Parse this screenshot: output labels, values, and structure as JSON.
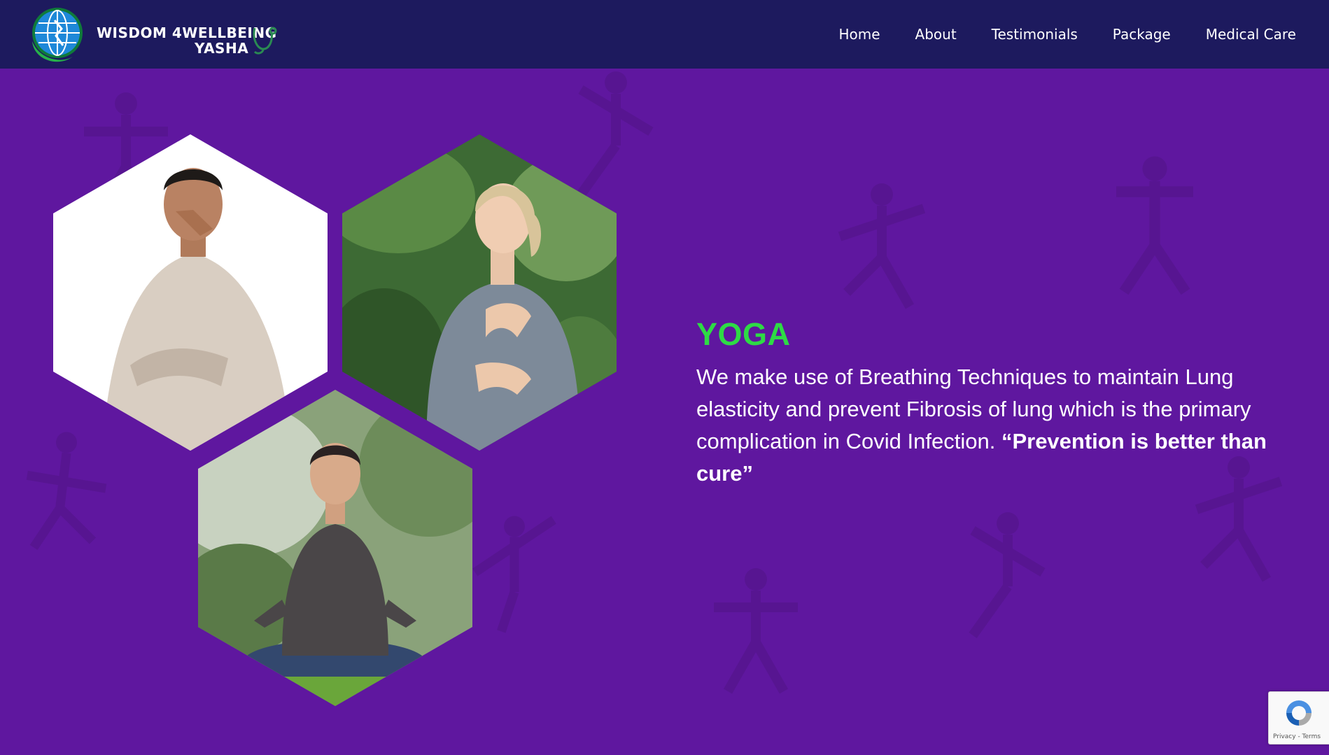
{
  "header": {
    "logo_line1": "WISDOM 4WELLBEING",
    "logo_line2": "YASHA",
    "nav": [
      "Home",
      "About",
      "Testimonials",
      "Package",
      "Medical Care"
    ]
  },
  "hero": {
    "title": "YOGA",
    "description": "We make use of Breathing Techniques to maintain Lung elasticity and prevent Fibrosis of lung which is the primary complication in Covid Infection.",
    "emphasis": "“Prevention is better than cure”",
    "images": [
      "man-breathing-photo",
      "woman-breathing-photo",
      "man-meditating-photo"
    ]
  },
  "recaptcha": {
    "links": "Privacy - Terms"
  },
  "colors": {
    "header_bg": "#1d1a5e",
    "hero_bg": "#5f179f",
    "accent_green": "#2edb45",
    "text": "#ffffff"
  }
}
